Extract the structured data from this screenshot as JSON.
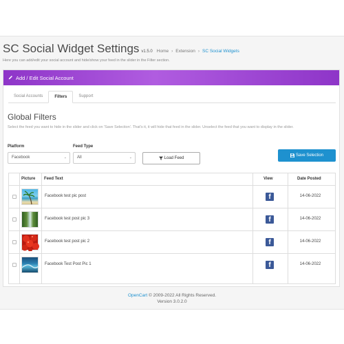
{
  "header": {
    "title": "SC Social Widget Settings",
    "version": "v1.5.0",
    "breadcrumb": [
      {
        "label": "Home"
      },
      {
        "label": "Extension"
      },
      {
        "label": "SC Social Widgets"
      }
    ],
    "breadcrumb_sep": "›",
    "subtitle": "Here you can add/edit your social account and hide/show your feed in the slider in the Filter section."
  },
  "panel": {
    "title": "Add / Edit Social Account",
    "pencil_icon": "pencil-icon"
  },
  "tabs": [
    {
      "label": "Social Accounts",
      "active": false
    },
    {
      "label": "Filters",
      "active": true
    },
    {
      "label": "Support",
      "active": false
    }
  ],
  "filters": {
    "title": "Global Filters",
    "help": "Select the feed you want to hide in the slider and click on 'Save Selection'. That's it, it will hide that feed in the slider. Unselect the feed that you want to display in the slider.",
    "platform_label": "Platform",
    "platform_value": "Facebook",
    "feed_type_label": "Feed Type",
    "feed_type_value": "All",
    "load_button": "Load Feed",
    "save_button": "Save Selection"
  },
  "table": {
    "columns": [
      "Picture",
      "Feed Text",
      "View",
      "Date Posted"
    ],
    "rows": [
      {
        "text": "Facebook test pic post",
        "view_icon": "facebook-icon",
        "date": "14-06-2022",
        "image": "beach-palm-photo"
      },
      {
        "text": "Facebook test post pic 3",
        "view_icon": "facebook-icon",
        "date": "14-06-2022",
        "image": "waterfall-photo"
      },
      {
        "text": "Facebook test post pic 2",
        "view_icon": "facebook-icon",
        "date": "14-06-2022",
        "image": "tomatoes-photo"
      },
      {
        "text": "Facebook Test Post Pic 1",
        "view_icon": "facebook-icon",
        "date": "14-06-2022",
        "image": "ocean-wave-photo"
      }
    ]
  },
  "footer": {
    "brand": "OpenCart",
    "copyright": "© 2009-2022 All Rights Reserved.",
    "version": "Version 3.0.2.0"
  },
  "colors": {
    "accent": "#1e91cf",
    "panel_gradient": "#8e35c8",
    "facebook": "#3b5998"
  }
}
